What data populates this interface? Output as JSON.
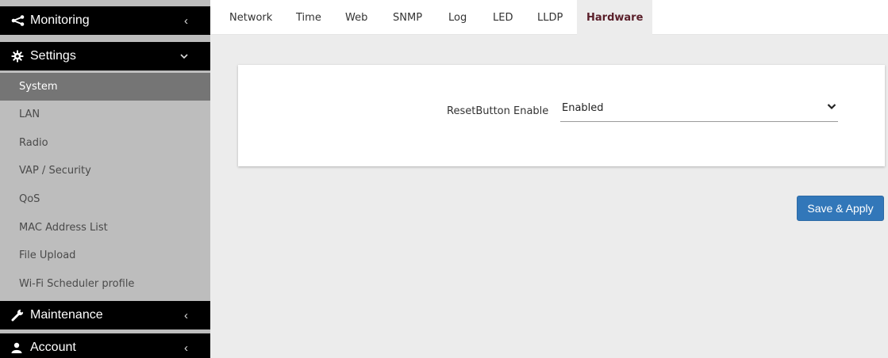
{
  "sidebar": {
    "sections": [
      {
        "label": "Monitoring",
        "icon": "share-icon"
      },
      {
        "label": "Settings",
        "icon": "gear-icon"
      },
      {
        "label": "Maintenance",
        "icon": "wrench-icon"
      },
      {
        "label": "Account",
        "icon": "user-icon"
      }
    ],
    "settings_items": [
      "System",
      "LAN",
      "Radio",
      "VAP / Security",
      "QoS",
      "MAC Address List",
      "File Upload",
      "Wi-Fi Scheduler profile"
    ],
    "active_item": "System"
  },
  "tabs": [
    {
      "label": "Network"
    },
    {
      "label": "Time"
    },
    {
      "label": "Web"
    },
    {
      "label": "SNMP"
    },
    {
      "label": "Log"
    },
    {
      "label": "LED"
    },
    {
      "label": "LLDP"
    },
    {
      "label": "Hardware"
    }
  ],
  "active_tab": "Hardware",
  "form": {
    "reset_button_label": "ResetButton Enable",
    "reset_button_value": "Enabled"
  },
  "actions": {
    "save_label": "Save & Apply"
  },
  "colors": {
    "header_bg": "#000000",
    "sidebar_bg": "#bdbdbd",
    "active_item_bg": "#757575",
    "active_tab_text": "#5a1f2a",
    "button_bg": "#3277b9",
    "page_bg": "#ececec"
  }
}
